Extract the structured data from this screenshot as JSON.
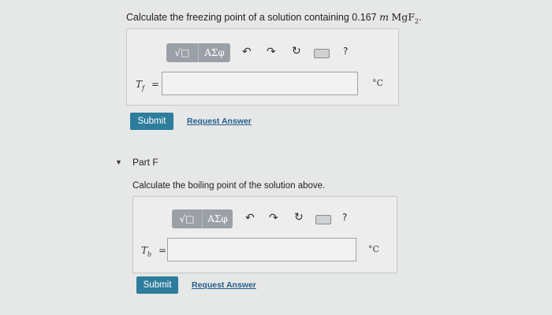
{
  "part_e": {
    "question_prefix": "Calculate the freezing point of a solution containing 0.167",
    "unit_symbol": "m",
    "compound": "MgF",
    "compound_sub": "2",
    "compound_suffix": ".",
    "toolbar": {
      "sqrt_label": "√□",
      "greek_label": "ΑΣφ",
      "help_label": "?"
    },
    "var_main": "T",
    "var_sub": "f",
    "equals": "=",
    "input_value": "",
    "unit": "°C",
    "submit_label": "Submit",
    "request_label": "Request Answer"
  },
  "part_f": {
    "title": "Part F",
    "question": "Calculate the boiling point of the solution above.",
    "toolbar": {
      "sqrt_label": "√□",
      "greek_label": "ΑΣφ",
      "help_label": "?"
    },
    "var_main": "T",
    "var_sub": "b",
    "equals": "=",
    "input_value": "",
    "unit": "°C",
    "submit_label": "Submit",
    "request_label": "Request Answer"
  },
  "icons": [
    "undo-icon",
    "redo-icon",
    "reset-icon",
    "keyboard-icon",
    "help-icon",
    "collapse-caret-icon"
  ]
}
